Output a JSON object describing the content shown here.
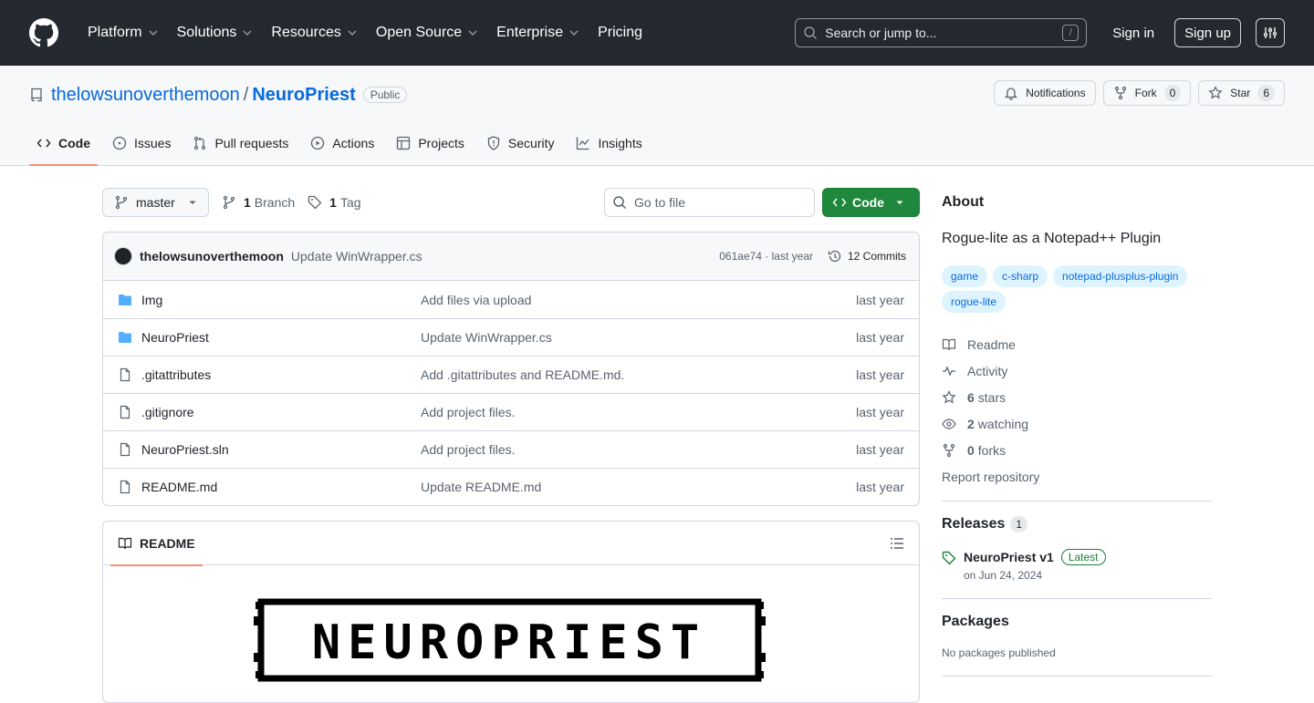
{
  "header": {
    "nav": [
      {
        "label": "Platform",
        "chevron": true
      },
      {
        "label": "Solutions",
        "chevron": true
      },
      {
        "label": "Resources",
        "chevron": true
      },
      {
        "label": "Open Source",
        "chevron": true
      },
      {
        "label": "Enterprise",
        "chevron": true
      },
      {
        "label": "Pricing",
        "chevron": false
      }
    ],
    "search_placeholder": "Search or jump to...",
    "search_shortcut": "/",
    "sign_in": "Sign in",
    "sign_up": "Sign up"
  },
  "repo": {
    "owner": "thelowsunoverthemoon",
    "separator": "/",
    "name": "NeuroPriest",
    "visibility": "Public",
    "notifications_label": "Notifications",
    "fork_label": "Fork",
    "fork_count": "0",
    "star_label": "Star",
    "star_count": "6",
    "tabs": [
      {
        "label": "Code",
        "icon": "code-icon",
        "active": true
      },
      {
        "label": "Issues",
        "icon": "issue-icon",
        "active": false
      },
      {
        "label": "Pull requests",
        "icon": "pull-request-icon",
        "active": false
      },
      {
        "label": "Actions",
        "icon": "play-icon",
        "active": false
      },
      {
        "label": "Projects",
        "icon": "table-icon",
        "active": false
      },
      {
        "label": "Security",
        "icon": "shield-icon",
        "active": false
      },
      {
        "label": "Insights",
        "icon": "graph-icon",
        "active": false
      }
    ]
  },
  "toolbar": {
    "branch": "master",
    "branch_count": "1",
    "branch_label": "Branch",
    "tag_count": "1",
    "tag_label": "Tag",
    "goto_placeholder": "Go to file",
    "code_label": "Code"
  },
  "latest_commit": {
    "author": "thelowsunoverthemoon",
    "message": "Update WinWrapper.cs",
    "meta": "061ae74 · last year",
    "commits_label": "12 Commits"
  },
  "files": [
    {
      "name": "Img",
      "type": "folder",
      "message": "Add files via upload",
      "date": "last year"
    },
    {
      "name": "NeuroPriest",
      "type": "folder",
      "message": "Update WinWrapper.cs",
      "date": "last year"
    },
    {
      "name": ".gitattributes",
      "type": "file",
      "message": "Add .gitattributes and README.md.",
      "date": "last year"
    },
    {
      "name": ".gitignore",
      "type": "file",
      "message": "Add project files.",
      "date": "last year"
    },
    {
      "name": "NeuroPriest.sln",
      "type": "file",
      "message": "Add project files.",
      "date": "last year"
    },
    {
      "name": "README.md",
      "type": "file",
      "message": "Update README.md",
      "date": "last year"
    }
  ],
  "readme": {
    "tab_label": "README",
    "banner_text": "NEUROPRIEST"
  },
  "about": {
    "title": "About",
    "description": "Rogue-lite as a Notepad++ Plugin",
    "topics": [
      "game",
      "c-sharp",
      "notepad-plusplus-plugin",
      "rogue-lite"
    ],
    "readme_label": "Readme",
    "activity_label": "Activity",
    "stars_count": "6",
    "stars_label": "stars",
    "watching_count": "2",
    "watching_label": "watching",
    "forks_count": "0",
    "forks_label": "forks",
    "report_label": "Report repository"
  },
  "releases": {
    "title": "Releases",
    "count": "1",
    "name": "NeuroPriest v1",
    "badge": "Latest",
    "date": "on Jun 24, 2024"
  },
  "packages": {
    "title": "Packages",
    "empty": "No packages published"
  },
  "colors": {
    "header_bg": "#24292f",
    "link": "#0969da",
    "accent_underline": "#fd8c73",
    "primary_button": "#1f883d",
    "folder_icon": "#54aeff"
  }
}
